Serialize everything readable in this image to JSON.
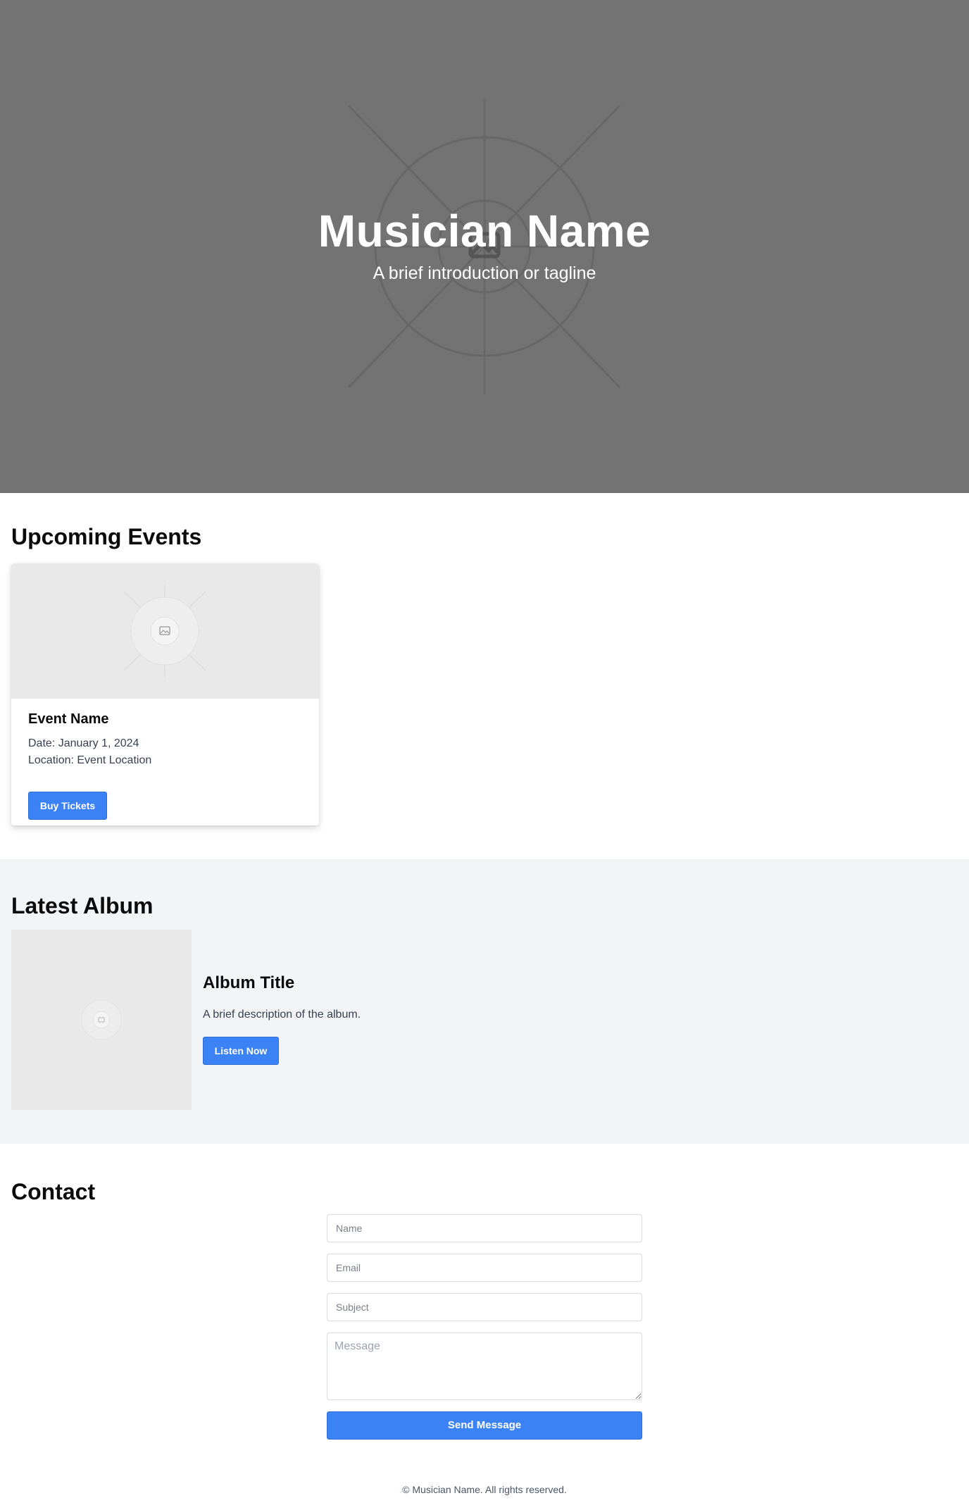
{
  "hero": {
    "title": "Musician Name",
    "tagline": "A brief introduction or tagline",
    "image_icon": "image-placeholder-icon"
  },
  "events": {
    "heading": "Upcoming Events",
    "items": [
      {
        "name": "Event Name",
        "date": "Date: January 1, 2024",
        "location": "Location: Event Location",
        "button_label": "Buy Tickets"
      }
    ]
  },
  "album": {
    "heading": "Latest Album",
    "title": "Album Title",
    "description": "A brief description of the album.",
    "button_label": "Listen Now"
  },
  "contact": {
    "heading": "Contact",
    "name_placeholder": "Name",
    "email_placeholder": "Email",
    "subject_placeholder": "Subject",
    "message_placeholder": "Message",
    "button_label": "Send Message"
  },
  "footer": {
    "text": "© Musician Name. All rights reserved."
  },
  "colors": {
    "hero_bg": "#737373",
    "accent": "#3b82f6",
    "album_bg": "#f3f4f6",
    "placeholder_bg": "#e9e9e9"
  }
}
